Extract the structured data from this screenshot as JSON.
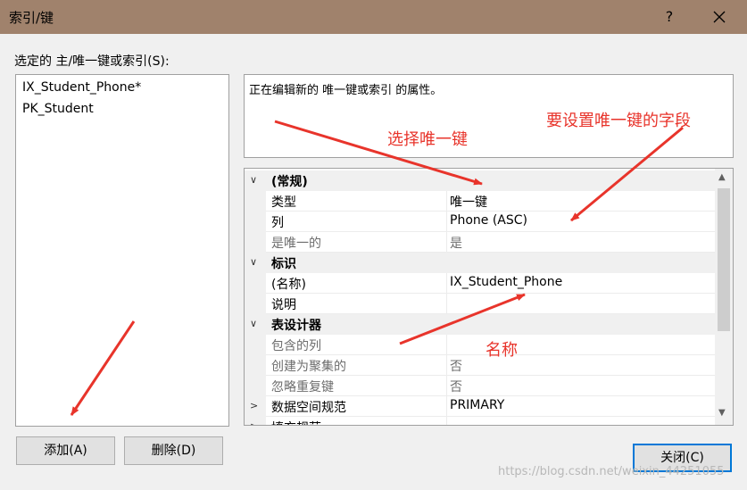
{
  "window": {
    "title": "索引/键",
    "help_glyph": "?"
  },
  "left": {
    "label": "选定的 主/唯一键或索引(S):",
    "items": [
      "IX_Student_Phone*",
      "PK_Student"
    ]
  },
  "description": "正在编辑新的 唯一键或索引 的属性。",
  "grid": {
    "rows": [
      {
        "kind": "category",
        "expander": "∨",
        "name": "(常规)"
      },
      {
        "kind": "prop",
        "name": "类型",
        "value": "唯一键"
      },
      {
        "kind": "prop",
        "name": "列",
        "value": "Phone (ASC)"
      },
      {
        "kind": "prop",
        "name": "是唯一的",
        "value": "是",
        "dim": true
      },
      {
        "kind": "category",
        "expander": "∨",
        "name": "标识"
      },
      {
        "kind": "prop",
        "name": "(名称)",
        "value": "IX_Student_Phone"
      },
      {
        "kind": "prop",
        "name": "说明",
        "value": ""
      },
      {
        "kind": "category",
        "expander": "∨",
        "name": "表设计器"
      },
      {
        "kind": "prop",
        "name": "包含的列",
        "value": "",
        "dim": true
      },
      {
        "kind": "prop",
        "name": "创建为聚集的",
        "value": "否",
        "dim": true
      },
      {
        "kind": "prop",
        "name": "忽略重复键",
        "value": "否",
        "dim": true
      },
      {
        "kind": "prop",
        "name": "数据空间规范",
        "value": "PRIMARY",
        "expander": ">"
      },
      {
        "kind": "prop",
        "name": "填充规范",
        "value": "",
        "expander": ">"
      }
    ]
  },
  "buttons": {
    "add": "添加(A)",
    "delete": "删除(D)",
    "close": "关闭(C)"
  },
  "annotations": {
    "select_unique": "选择唯一键",
    "set_field": "要设置唯一键的字段",
    "name": "名称"
  },
  "watermark": "https://blog.csdn.net/weixin_44251055",
  "colors": {
    "titlebar": "#a0826c",
    "annotation": "#e8342b",
    "default_button_border": "#0078d7"
  }
}
